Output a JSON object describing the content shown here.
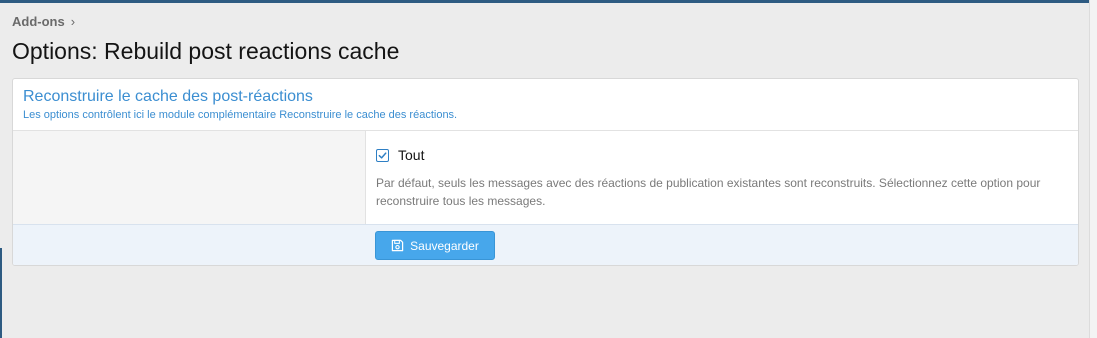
{
  "breadcrumb": {
    "items": [
      {
        "label": "Add-ons",
        "separator": "›"
      }
    ]
  },
  "page": {
    "title": "Options: Rebuild post reactions cache"
  },
  "block": {
    "title": "Reconstruire le cache des post-réactions",
    "description": "Les options contrôlent ici le module complémentaire Reconstruire le cache des réactions."
  },
  "option": {
    "checked": true,
    "label": "Tout",
    "hint": "Par défaut, seuls les messages avec des réactions de publication existantes sont reconstruits. Sélectionnez cette option pour reconstruire tous les messages."
  },
  "actions": {
    "save_label": "Sauvegarder"
  },
  "icons": {
    "breadcrumb_separator": "chevron-right-icon",
    "checkbox": "checkmark-icon",
    "save": "save-icon"
  },
  "colors": {
    "accent": "#47a7eb",
    "link": "#3b8ed1",
    "submit_row_bg": "#edf3fa",
    "page_bg": "#ececec"
  }
}
